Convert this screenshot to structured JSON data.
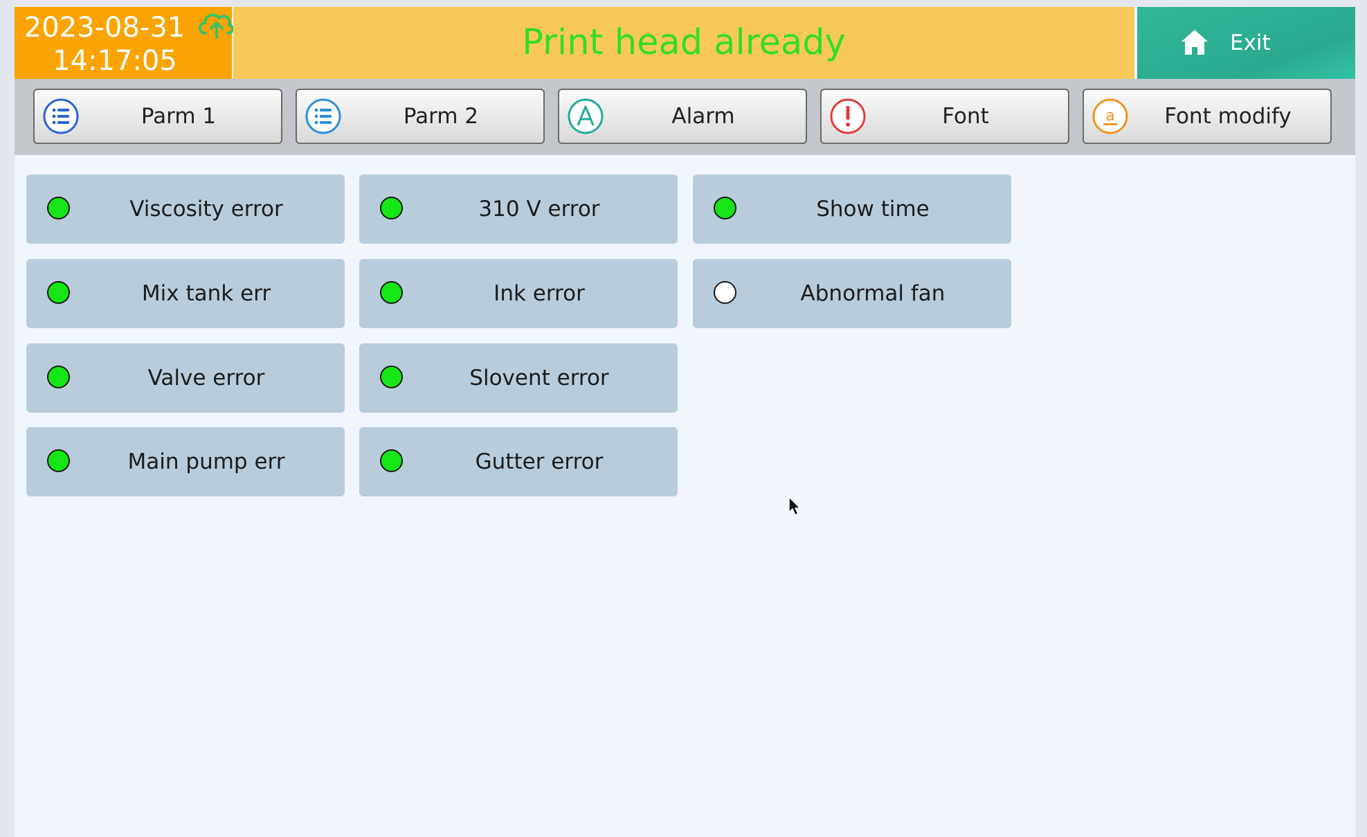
{
  "header": {
    "date": "2023-08-31",
    "time": "14:17:05",
    "status": "Print head already",
    "exit_label": "Exit"
  },
  "tabs": [
    {
      "label": "Parm 1",
      "icon": "list-icon",
      "color": "#2a62d8"
    },
    {
      "label": "Parm 2",
      "icon": "list-icon",
      "color": "#2a8fd8"
    },
    {
      "label": "Alarm",
      "icon": "alarm-a-icon",
      "color": "#22aa99"
    },
    {
      "label": "Font",
      "icon": "exclamation-icon",
      "color": "#e23b3b"
    },
    {
      "label": "Font modify",
      "icon": "letter-a-icon",
      "color": "#f0951c"
    }
  ],
  "indicators": [
    {
      "label": "Viscosity error",
      "state": "ok"
    },
    {
      "label": "Mix tank err",
      "state": "ok"
    },
    {
      "label": "Valve error",
      "state": "ok"
    },
    {
      "label": "Main pump err",
      "state": "ok"
    },
    {
      "label": "310 V error",
      "state": "ok"
    },
    {
      "label": "Ink error",
      "state": "ok"
    },
    {
      "label": "Slovent error",
      "state": "ok"
    },
    {
      "label": "Gutter error",
      "state": "ok"
    },
    {
      "label": "Show time",
      "state": "ok"
    },
    {
      "label": "Abnormal fan",
      "state": "off"
    }
  ],
  "colors": {
    "datetime_bg": "#f9a404",
    "status_bg": "#f8c95a",
    "status_text": "#33dd22",
    "exit_bg": "#2fb898",
    "indicator_on": "#15e615",
    "indicator_off": "#ffffff",
    "card_bg": "#b9ccdb"
  }
}
